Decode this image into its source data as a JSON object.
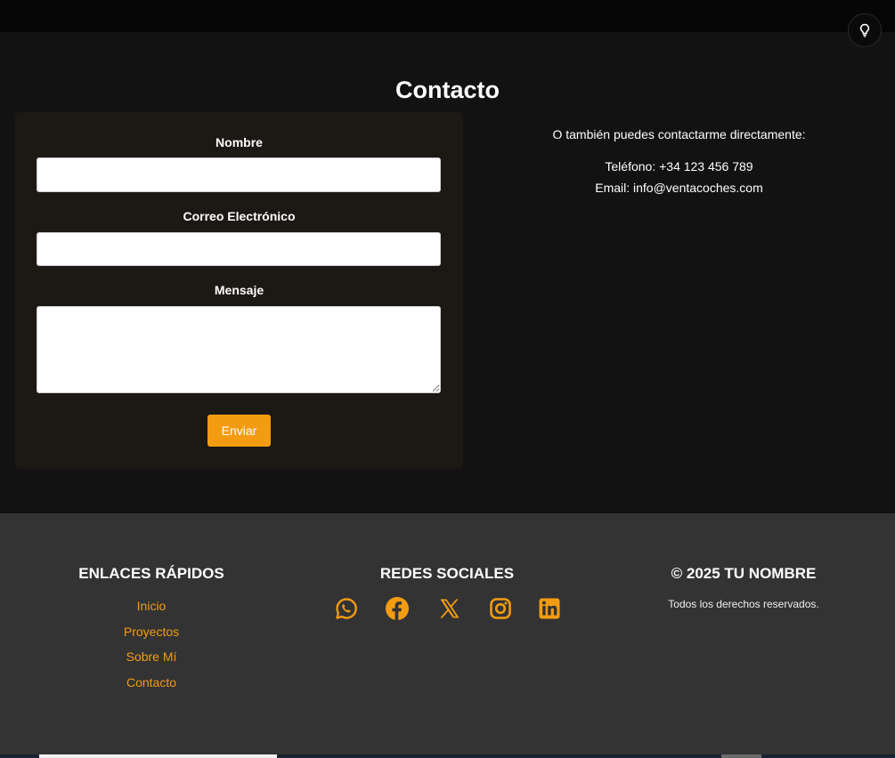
{
  "contact": {
    "title": "Contacto",
    "form": {
      "name_label": "Nombre",
      "name_value": "",
      "email_label": "Correo Electrónico",
      "email_value": "",
      "message_label": "Mensaje",
      "message_value": "",
      "submit_label": "Enviar"
    },
    "direct": {
      "intro": "O también puedes contactarme directamente:",
      "phone": "Teléfono: +34 123 456 789",
      "email": "Email: info@ventacoches.com"
    }
  },
  "theme_toggle": {
    "icon": "lightbulb-icon"
  },
  "footer": {
    "links_heading": "ENLACES RÁPIDOS",
    "links": [
      "Inicio",
      "Proyectos",
      "Sobre Mí",
      "Contacto"
    ],
    "social_heading": "REDES SOCIALES",
    "social_icons": [
      "whatsapp-icon",
      "facebook-icon",
      "x-icon",
      "instagram-icon",
      "linkedin-icon"
    ],
    "copyright_heading": "© 2025 TU NOMBRE",
    "copyright_sub": "Todos los derechos reservados."
  },
  "colors": {
    "accent": "#f39c12",
    "background": "#121212",
    "card": "#1c1814",
    "footer": "#333333"
  }
}
